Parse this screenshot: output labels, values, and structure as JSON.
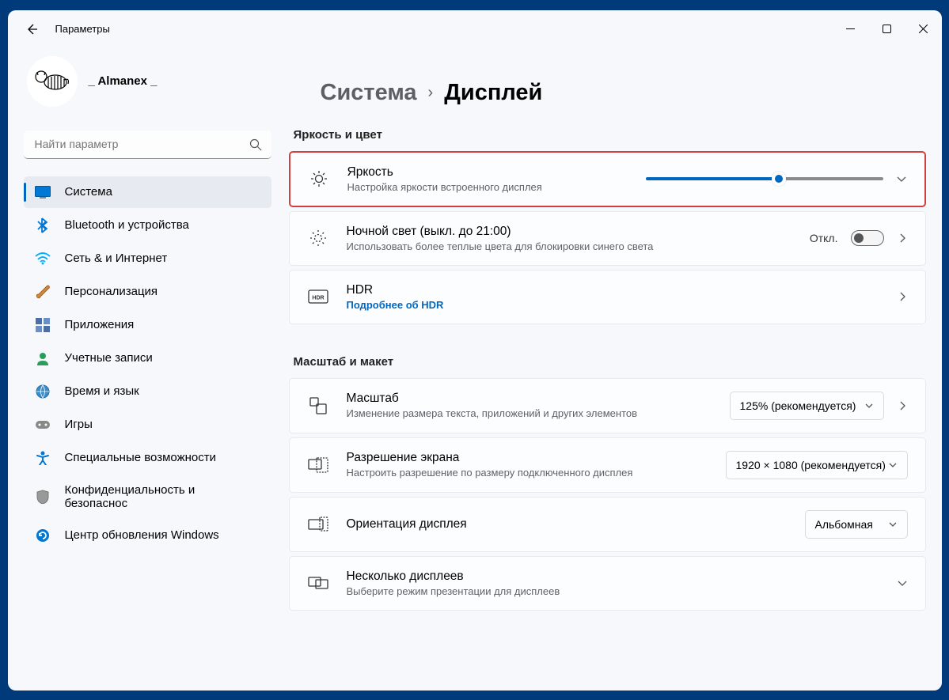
{
  "window": {
    "title": "Параметры"
  },
  "profile": {
    "username": "_ Almanex _"
  },
  "search": {
    "placeholder": "Найти параметр"
  },
  "nav": [
    {
      "label": "Система"
    },
    {
      "label": "Bluetooth и устройства"
    },
    {
      "label": "Сеть & и Интернет"
    },
    {
      "label": "Персонализация"
    },
    {
      "label": "Приложения"
    },
    {
      "label": "Учетные записи"
    },
    {
      "label": "Время и язык"
    },
    {
      "label": "Игры"
    },
    {
      "label": "Специальные возможности"
    },
    {
      "label": "Конфиденциальность и безопаснос"
    },
    {
      "label": "Центр обновления Windows"
    }
  ],
  "breadcrumb": {
    "parent": "Система",
    "current": "Дисплей"
  },
  "sections": {
    "brightness_color": "Яркость и цвет",
    "scale_layout": "Масштаб и макет"
  },
  "cards": {
    "brightness": {
      "title": "Яркость",
      "subtitle": "Настройка яркости встроенного дисплея",
      "slider_pct": 56
    },
    "nightlight": {
      "title": "Ночной свет (выкл. до 21:00)",
      "subtitle": "Использовать более теплые цвета для блокировки синего света",
      "toggle_label": "Откл."
    },
    "hdr": {
      "title": "HDR",
      "link": "Подробнее об HDR"
    },
    "scale": {
      "title": "Масштаб",
      "subtitle": "Изменение размера текста, приложений и других элементов",
      "value": "125% (рекомендуется)"
    },
    "resolution": {
      "title": "Разрешение экрана",
      "subtitle": "Настроить разрешение по размеру подключенного дисплея",
      "value": "1920 × 1080 (рекомендуется)"
    },
    "orientation": {
      "title": "Ориентация дисплея",
      "value": "Альбомная"
    },
    "multiple": {
      "title": "Несколько дисплеев",
      "subtitle": "Выберите режим презентации для дисплеев"
    }
  }
}
